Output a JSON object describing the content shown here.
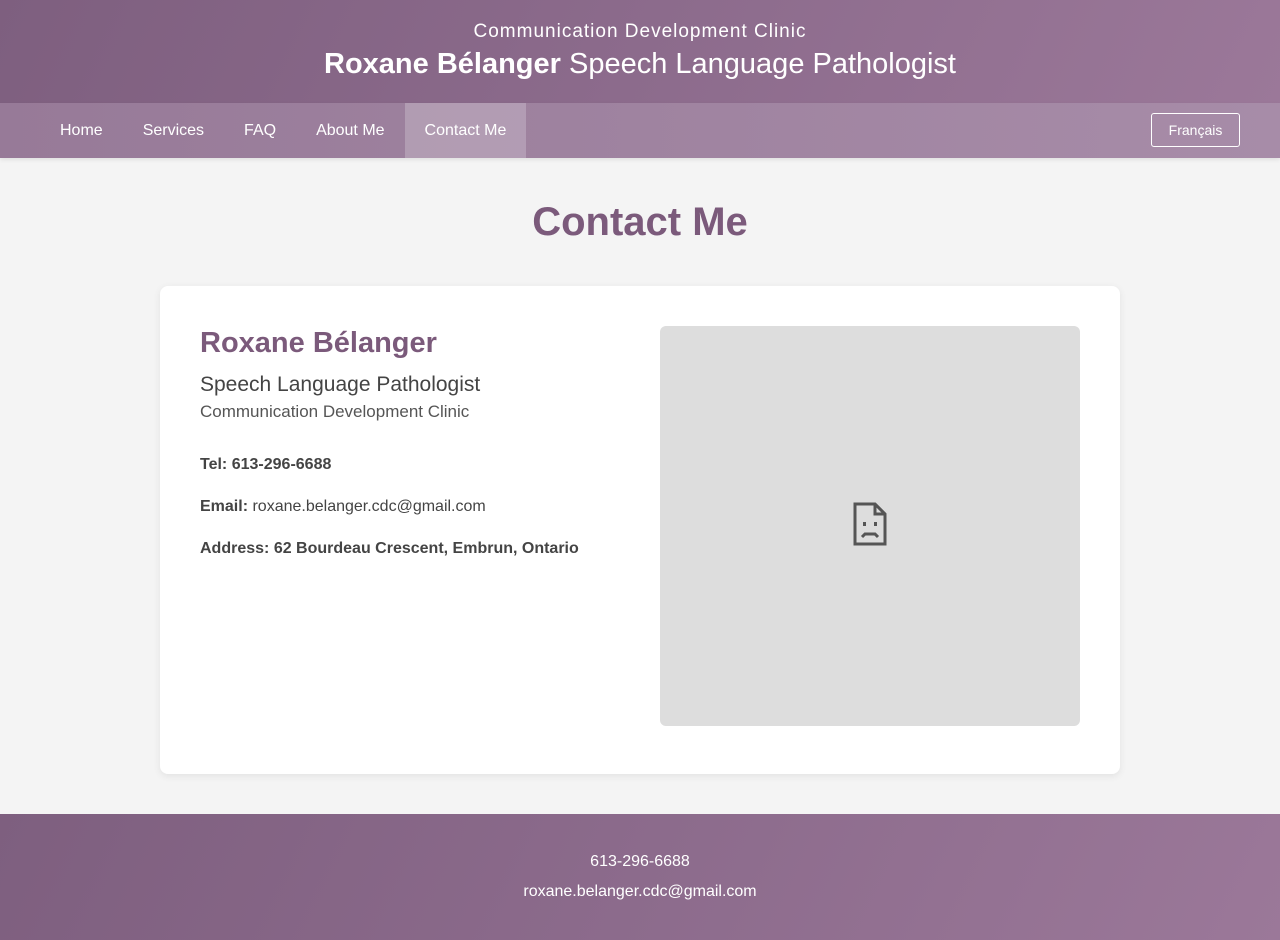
{
  "header": {
    "clinic_name": "Communication Development Clinic",
    "title_name": "Roxane Bélanger",
    "title_role": "Speech Language Pathologist"
  },
  "nav": {
    "items": [
      {
        "label": "Home"
      },
      {
        "label": "Services"
      },
      {
        "label": "FAQ"
      },
      {
        "label": "About Me"
      },
      {
        "label": "Contact Me",
        "active": true
      }
    ],
    "language_button": "Français"
  },
  "main": {
    "page_title": "Contact Me",
    "contact": {
      "name": "Roxane Bélanger",
      "role": "Speech Language Pathologist",
      "clinic": "Communication Development Clinic",
      "tel_label": "Tel:",
      "tel_value": "613-296-6688",
      "email_label": "Email:",
      "email_value": "roxane.belanger.cdc@gmail.com",
      "address_label": "Address:",
      "address_value": "62 Bourdeau Crescent, Embrun, Ontario"
    },
    "map": {
      "icon": "broken-document-icon"
    }
  },
  "footer": {
    "phone": "613-296-6688",
    "email": "roxane.belanger.cdc@gmail.com"
  },
  "colors": {
    "brand_purple": "#7b5a7b",
    "header_gradient_start": "#7e5f7f",
    "header_gradient_end": "#9b7899",
    "page_background": "#f4f4f4",
    "map_placeholder": "#dddddd"
  }
}
